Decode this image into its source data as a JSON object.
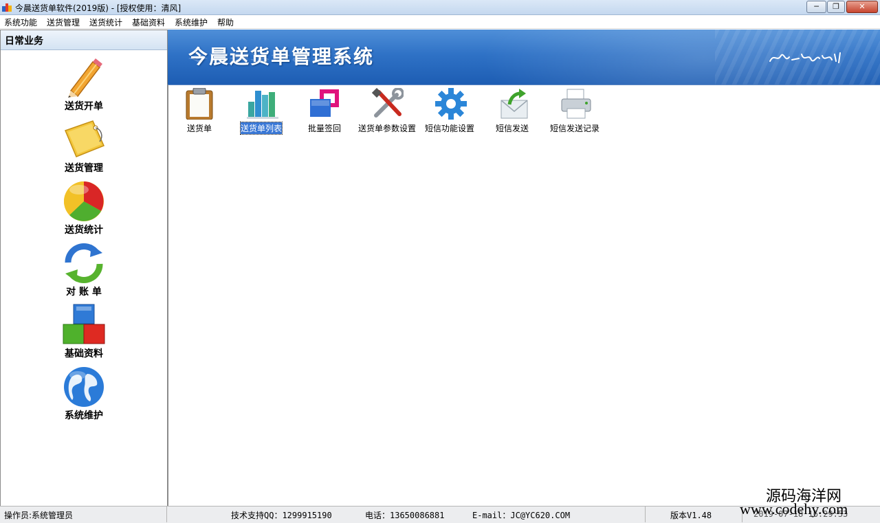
{
  "window": {
    "title": "今晨送货单软件(2019版) - [授权使用：清风]",
    "controls": {
      "minimize": "minimize-icon",
      "maximize": "restore-icon",
      "close": "close-icon"
    }
  },
  "menu": [
    "系统功能",
    "送货管理",
    "送货统计",
    "基础资料",
    "系统维护",
    "帮助"
  ],
  "sidebar": {
    "header": "日常业务",
    "items": [
      {
        "label": "送货开单",
        "icon": "pencil-icon"
      },
      {
        "label": "送货管理",
        "icon": "tag-icon"
      },
      {
        "label": "送货统计",
        "icon": "pie-chart-icon"
      },
      {
        "label": "对 账 单",
        "icon": "refresh-arrows-icon"
      },
      {
        "label": "基础资料",
        "icon": "blocks-icon"
      },
      {
        "label": "系统维护",
        "icon": "globe-icon"
      }
    ]
  },
  "banner": {
    "title": "今晨送货单管理系统",
    "slogan_icon": "handwritten-slogan-icon",
    "colors": {
      "top": "#4f8fd8",
      "bottom": "#1d5db3"
    }
  },
  "toolbar": [
    {
      "label": "送货单",
      "icon": "clipboard-icon",
      "selected": false
    },
    {
      "label": "送货单列表",
      "icon": "bar-chart-icon",
      "selected": true
    },
    {
      "label": "批量签回",
      "icon": "overlapping-squares-icon",
      "selected": false
    },
    {
      "label": "送货单参数设置",
      "icon": "tools-icon",
      "selected": false
    },
    {
      "label": "短信功能设置",
      "icon": "gear-icon",
      "selected": false
    },
    {
      "label": "短信发送",
      "icon": "envelope-arrow-icon",
      "selected": false
    },
    {
      "label": "短信发送记录",
      "icon": "printer-icon",
      "selected": false
    }
  ],
  "status": {
    "operator": "操作员:系统管理员",
    "support_qq": "技术支持QQ：1299915190",
    "phone": "电话：13650086881",
    "email": "E-mail：JC@YC620.COM",
    "version": "版本V1.48",
    "datetime": "2019-07-18 16:29:53"
  },
  "watermark": {
    "line1": "源码海洋网",
    "line2": "www.codehy.com"
  },
  "colors": {
    "selection": "#3a78d6",
    "status_bg": "#ecedef"
  }
}
